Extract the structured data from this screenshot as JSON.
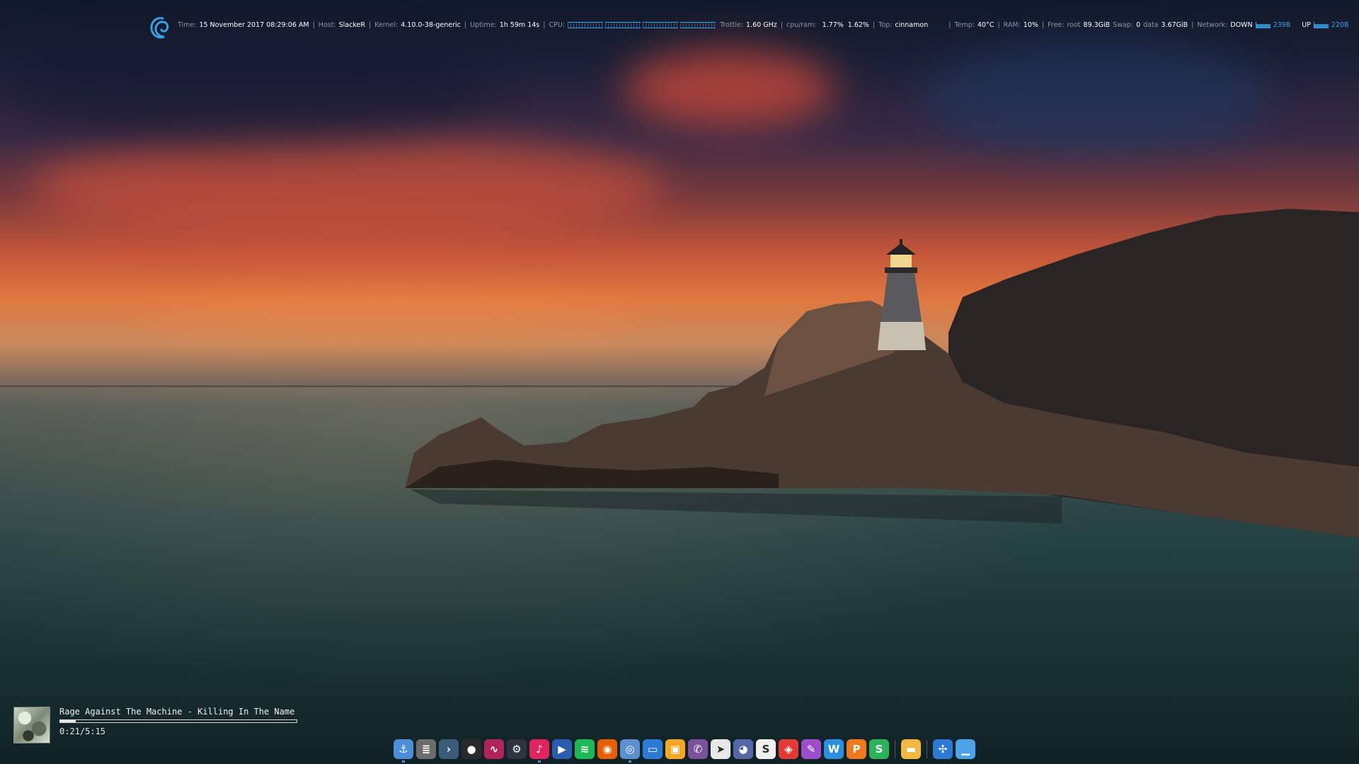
{
  "conky": {
    "time_label": "Time:",
    "time_value": "15 November 2017 08:29:06 AM",
    "host_label": "Host:",
    "host_value": "SlackeR",
    "kernel_label": "Kernel:",
    "kernel_value": "4.10.0-38-generic",
    "uptime_label": "Uptime:",
    "uptime_value": "1h 59m 14s",
    "cpu_label": "CPU:",
    "trottle_label": "Trottle:",
    "trottle_value": "1.60 GHz",
    "cpuram_label": "cpu/ram:",
    "cpu_value": "1.77%",
    "ram_value": "1.62%",
    "top_label": "Top:",
    "top_value": "cinnamon",
    "temp_label": "Temp:",
    "temp_value": "40°C",
    "ram_label": "RAM:",
    "ram_percent": "10%",
    "free_label": "Free:",
    "root_label": "root",
    "root_value": "89.3GiB",
    "swap_label": "Swap:",
    "swap_value": "0",
    "data_label": "data",
    "data_value": "3.67GiB",
    "network_label": "Network:",
    "down_label": "DOWN",
    "down_value": "239B",
    "up_label": "UP",
    "up_value": "220B",
    "separator": "|"
  },
  "music": {
    "title": "Rage Against The Machine - Killing In The Name",
    "time": "0:21/5:15",
    "progress": 0.067
  },
  "dock": {
    "items": [
      {
        "name": "anchor-icon",
        "glyph": "⚓",
        "color": "#4a8fd8",
        "running": true
      },
      {
        "name": "file-manager-icon",
        "glyph": "≣",
        "color": "#6c6c6c",
        "running": false
      },
      {
        "name": "terminal-icon",
        "glyph": "›",
        "color": "#3c5a7a",
        "running": false
      },
      {
        "name": "obs-icon",
        "glyph": "●",
        "color": "#2a2a2a",
        "running": false
      },
      {
        "name": "audio-waveform-icon",
        "glyph": "∿",
        "color": "#b0245a",
        "running": false
      },
      {
        "name": "steam-icon",
        "glyph": "⚙",
        "color": "#2d3440",
        "running": false
      },
      {
        "name": "music-player-icon",
        "glyph": "♪",
        "color": "#e0245e",
        "running": true
      },
      {
        "name": "play-store-icon",
        "glyph": "▶",
        "color": "#2a5db0",
        "running": false
      },
      {
        "name": "spotify-icon",
        "glyph": "≋",
        "color": "#1db954",
        "running": false
      },
      {
        "name": "firefox-icon",
        "glyph": "◉",
        "color": "#e66000",
        "running": false
      },
      {
        "name": "chromium-icon",
        "glyph": "◎",
        "color": "#5a8fd0",
        "running": true
      },
      {
        "name": "remote-desktop-icon",
        "glyph": "▭",
        "color": "#2b7bd6",
        "running": false
      },
      {
        "name": "screenshot-icon",
        "glyph": "▣",
        "color": "#f5a623",
        "running": false
      },
      {
        "name": "viber-icon",
        "glyph": "✆",
        "color": "#7b519d",
        "running": false
      },
      {
        "name": "telegram-icon",
        "glyph": "➤",
        "color": "#e8e8e8",
        "running": false
      },
      {
        "name": "discord-icon",
        "glyph": "◕",
        "color": "#5865a6",
        "running": false
      },
      {
        "name": "skype-icon",
        "glyph": "S",
        "color": "#f0f0f0",
        "running": false
      },
      {
        "name": "package-icon",
        "glyph": "◈",
        "color": "#e53935",
        "running": false
      },
      {
        "name": "editor-icon",
        "glyph": "✎",
        "color": "#9b4dca",
        "running": false
      },
      {
        "name": "wps-writer-icon",
        "glyph": "W",
        "color": "#2b8fe0",
        "running": false
      },
      {
        "name": "wps-presentation-icon",
        "glyph": "P",
        "color": "#f07a1a",
        "running": false
      },
      {
        "name": "wps-spreadsheet-icon",
        "glyph": "S",
        "color": "#2ab35a",
        "running": false
      },
      {
        "name": "folder-icon",
        "glyph": "▬",
        "color": "#f4b740",
        "running": false
      },
      {
        "name": "network-icon",
        "glyph": "✣",
        "color": "#2b7bd6",
        "running": false
      },
      {
        "name": "show-desktop-icon",
        "glyph": "▁",
        "color": "#4aa3e6",
        "running": false
      }
    ]
  },
  "colors": {
    "accent": "#3aa0e6",
    "conky_label": "#8a96a6"
  }
}
